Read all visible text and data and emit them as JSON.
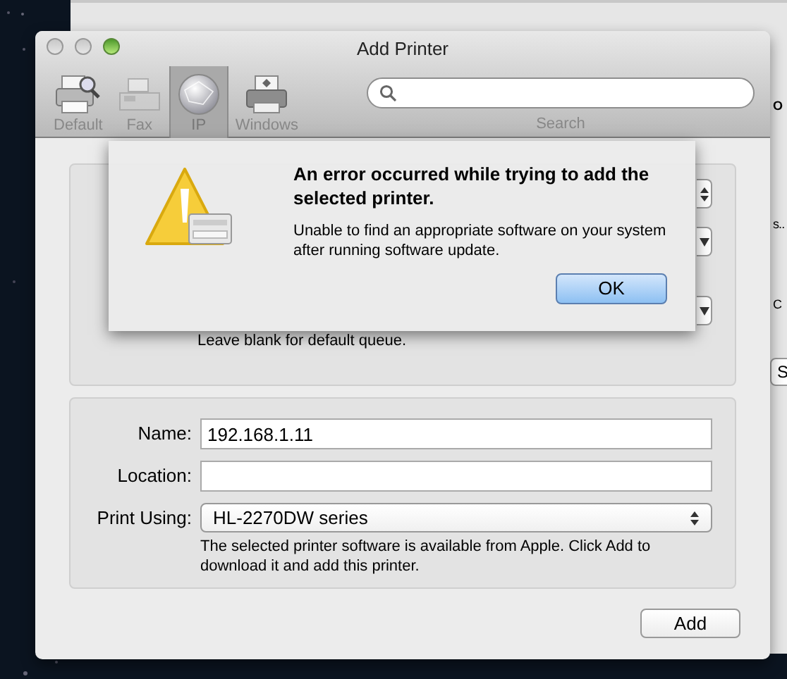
{
  "background_window": {
    "fragments": [
      "O",
      "s..",
      "C",
      "S"
    ]
  },
  "window": {
    "title": "Add Printer"
  },
  "toolbar": {
    "items": [
      {
        "label": "Default",
        "selected": false,
        "kind": "default"
      },
      {
        "label": "Fax",
        "selected": false,
        "kind": "fax"
      },
      {
        "label": "IP",
        "selected": true,
        "kind": "ip"
      },
      {
        "label": "Windows",
        "selected": false,
        "kind": "windows"
      }
    ],
    "search": {
      "label": "Search"
    }
  },
  "connection": {
    "queue": {
      "hint": "Leave blank for default queue."
    }
  },
  "alert": {
    "title": "An error occurred while trying to add the selected printer.",
    "message": "Unable to find an appropriate software on your system after running software update.",
    "button": "OK"
  },
  "details": {
    "name": {
      "label": "Name:",
      "value": "192.168.1.11"
    },
    "location": {
      "label": "Location:"
    },
    "print_using": {
      "label": "Print Using:",
      "value": "HL-2270DW series"
    },
    "note": "The selected printer software is available from Apple. Click Add to download it and add this printer."
  },
  "add_button": "Add"
}
